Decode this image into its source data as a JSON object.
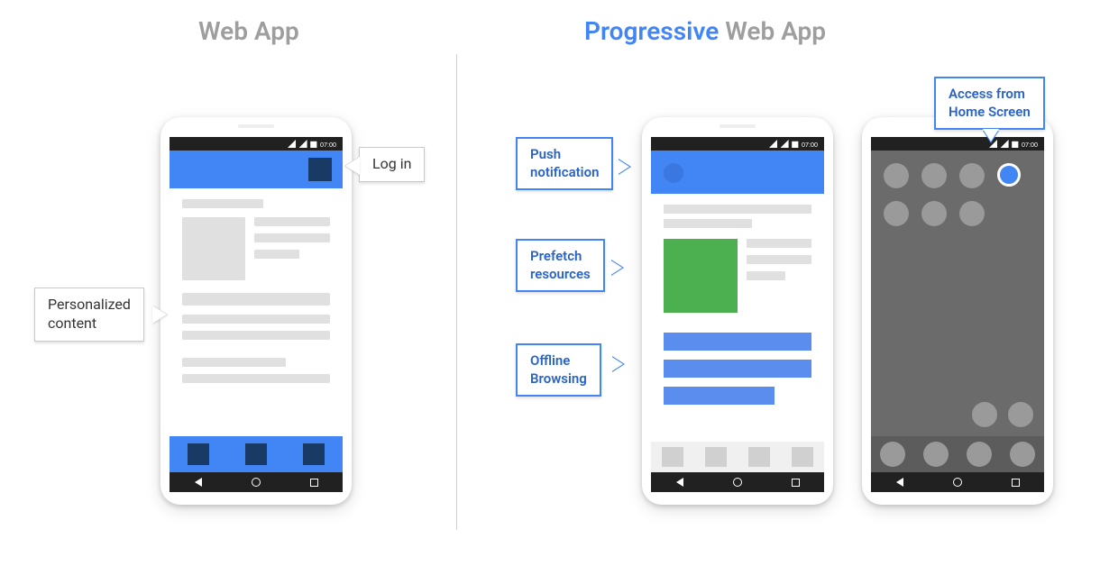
{
  "titles": {
    "left": "Web App",
    "right_accent": "Progressive",
    "right_rest": " Web App"
  },
  "labels": {
    "login": "Log in",
    "personalized": "Personalized\ncontent",
    "push": "Push\nnotification",
    "prefetch": "Prefetch\nresources",
    "offline": "Offline\nBrowsing",
    "homescreen": "Access from\nHome Screen"
  },
  "status_time": "07:00"
}
